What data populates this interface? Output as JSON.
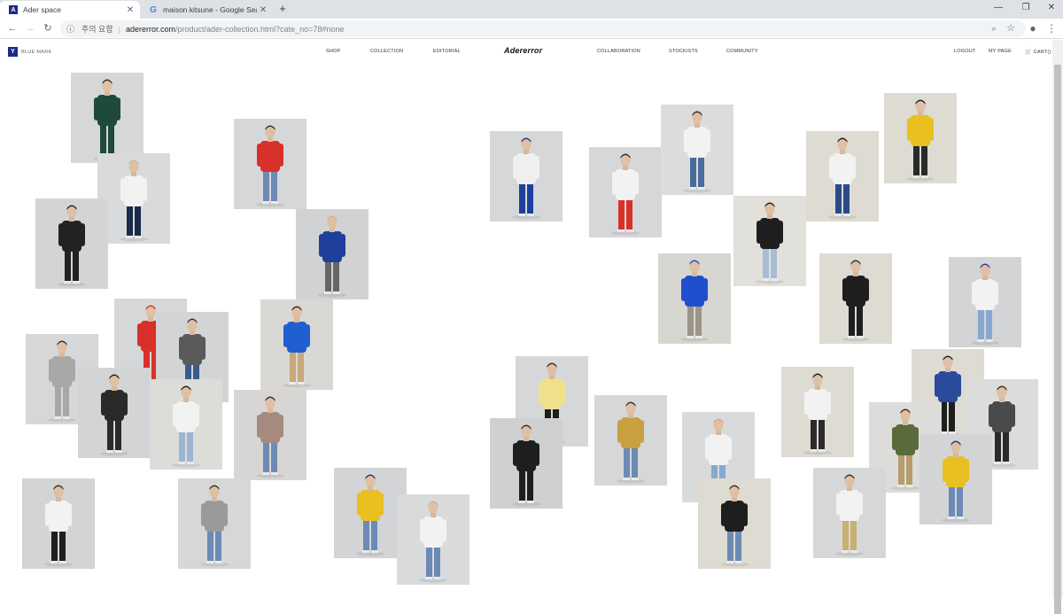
{
  "browser": {
    "tabs": [
      {
        "title": "Ader space",
        "favicon": "A",
        "active": true
      },
      {
        "title": "maison kitsune - Google Search",
        "favicon": "G",
        "active": false
      }
    ],
    "new_tab": "+",
    "window_controls": {
      "minimize": "—",
      "restore": "❐",
      "close": "✕"
    },
    "nav": {
      "back": "←",
      "forward": "→",
      "reload": "↻"
    },
    "address": {
      "warning": "주의 요함",
      "host": "adererror.com",
      "path": "/product/ader-collection.html?cate_no=78#none"
    },
    "toolbar_icons": {
      "zoom": "🔍",
      "star": "☆",
      "profile": "●",
      "menu": "⋮"
    }
  },
  "site": {
    "left_logo_mark": "Y",
    "left_logo_text": "BLUE MARK",
    "menu": [
      "SHOP",
      "COLLECTION",
      "EDITORIAL",
      "COLLABORATION",
      "STOCKISTS",
      "COMMUNITY"
    ],
    "brand": "Adererror",
    "account": {
      "logout": "LOGOUT",
      "mypage": "MY PAGE",
      "cart": "CART()"
    }
  },
  "lookbook": [
    {
      "id": 1,
      "bg": "#d6d7d9",
      "top": "#1e4a3c",
      "bottom": "#1e4a3c",
      "hair": "#3a2a1c"
    },
    {
      "id": 2,
      "bg": "#d9dadb",
      "top": "#f2f2f2",
      "bottom": "#1c2a4a",
      "hair": "#c9b48c"
    },
    {
      "id": 3,
      "bg": "#d3d4d6",
      "top": "#222222",
      "bottom": "#222222",
      "hair": "#222222"
    },
    {
      "id": 4,
      "bg": "#d6d7d9",
      "top": "#d8302a",
      "bottom": "#6c8ab5",
      "hair": "#3a2a1c"
    },
    {
      "id": 5,
      "bg": "#d1d2d4",
      "top": "#1f3f9c",
      "bottom": "#666666",
      "hair": "#c9b48c"
    },
    {
      "id": 6,
      "bg": "#d6d7d9",
      "top": "#d8302a",
      "bottom": "#d8302a",
      "hair": "#d8302a"
    },
    {
      "id": 7,
      "bg": "#d3d4d6",
      "top": "#5a5a5a",
      "bottom": "#3c5a8c",
      "hair": "#2a2f6c"
    },
    {
      "id": 8,
      "bg": "#d9d8d4",
      "top": "#1f5fcf",
      "bottom": "#c9a87a",
      "hair": "#3a2a1c"
    },
    {
      "id": 9,
      "bg": "#d6d7d9",
      "top": "#a8a8a8",
      "bottom": "#a8a8a8",
      "hair": "#3a2a1c"
    },
    {
      "id": 10,
      "bg": "#d3d4d6",
      "top": "#2a2a2a",
      "bottom": "#2a2a2a",
      "hair": "#1c1c1c"
    },
    {
      "id": 11,
      "bg": "#dcdcd8",
      "top": "#f2f2f2",
      "bottom": "#9cb5d3",
      "hair": "#1c1c1c"
    },
    {
      "id": 12,
      "bg": "#d7d6d4",
      "top": "#a68a80",
      "bottom": "#6c8ab5",
      "hair": "#3a2a1c"
    },
    {
      "id": 13,
      "bg": "#d6d7d9",
      "top": "#efefef",
      "bottom": "#1f3f9c",
      "hair": "#2a2f6c"
    },
    {
      "id": 14,
      "bg": "#d6d7d9",
      "top": "#f2f2f2",
      "bottom": "#d8302a",
      "hair": "#3a2a1c"
    },
    {
      "id": 15,
      "bg": "#dcdcda",
      "top": "#f2f2f2",
      "bottom": "#4a6c9c",
      "hair": "#3a2a1c"
    },
    {
      "id": 16,
      "bg": "#e2e0da",
      "top": "#1e1e1e",
      "bottom": "#a8bcd3",
      "hair": "#1c1c1c"
    },
    {
      "id": 17,
      "bg": "#dedbd3",
      "top": "#f2f2f2",
      "bottom": "#2a4a8c",
      "hair": "#1c1c1c"
    },
    {
      "id": 18,
      "bg": "#dedbd3",
      "top": "#e8c020",
      "bottom": "#2a2a2a",
      "hair": "#1c1c1c"
    },
    {
      "id": 19,
      "bg": "#d8d6d0",
      "top": "#1f4fcf",
      "bottom": "#9c948a",
      "hair": "#1f4fcf"
    },
    {
      "id": 20,
      "bg": "#dedbd3",
      "top": "#1e1e1e",
      "bottom": "#1e1e1e",
      "hair": "#3a2a1c"
    },
    {
      "id": 21,
      "bg": "#d3d4d6",
      "top": "#f2f2f2",
      "bottom": "#8aa8cf",
      "hair": "#3a3a8c"
    },
    {
      "id": 22,
      "bg": "#d6d7d9",
      "top": "#efe08c",
      "bottom": "#1e1e1e",
      "hair": "#3a2a1c"
    },
    {
      "id": 23,
      "bg": "#cfd0d2",
      "top": "#1e1e1e",
      "bottom": "#1e1e1e",
      "hair": "#3a2a1c"
    },
    {
      "id": 24,
      "bg": "#d6d7d9",
      "top": "#c8a040",
      "bottom": "#6c8ab5",
      "hair": "#3a2a1c"
    },
    {
      "id": 25,
      "bg": "#d9dadb",
      "top": "#f2f2f2",
      "bottom": "#8aa8cf",
      "hair": "#d8a0a0"
    },
    {
      "id": 26,
      "bg": "#dedbd3",
      "top": "#1e1e1e",
      "bottom": "#6c8ab5",
      "hair": "#3a2a1c"
    },
    {
      "id": 27,
      "bg": "#dedbd3",
      "top": "#f2f2f2",
      "bottom": "#2a2a2a",
      "hair": "#1c1c1c"
    },
    {
      "id": 28,
      "bg": "#dedbd3",
      "top": "#2a4a9c",
      "bottom": "#1e1e1e",
      "hair": "#1c1c1c"
    },
    {
      "id": 29,
      "bg": "#dcdcda",
      "top": "#4a4a4a",
      "bottom": "#2a2a2a",
      "hair": "#3a2a1c"
    },
    {
      "id": 30,
      "bg": "#dcdcda",
      "top": "#5a6a3a",
      "bottom": "#b89c6c",
      "hair": "#3a2a1c"
    },
    {
      "id": 31,
      "bg": "#d3d4d6",
      "top": "#e8c020",
      "bottom": "#6c8ab5",
      "hair": "#2a2f6c"
    },
    {
      "id": 32,
      "bg": "#d6d7d9",
      "top": "#f2f2f2",
      "bottom": "#c8b070",
      "hair": "#3a2a1c"
    },
    {
      "id": 33,
      "bg": "#d3d4d6",
      "top": "#f2f2f2",
      "bottom": "#1e1e1e",
      "hair": "#3a2a1c"
    },
    {
      "id": 34,
      "bg": "#d6d7d9",
      "top": "#9a9a9a",
      "bottom": "#6c8ab5",
      "hair": "#3a2a1c"
    },
    {
      "id": 35,
      "bg": "#d3d4d6",
      "top": "#e8c020",
      "bottom": "#6c8ab5",
      "hair": "#2a2f6c"
    },
    {
      "id": 36,
      "bg": "#d9dadb",
      "top": "#f2f2f2",
      "bottom": "#6c8ab5",
      "hair": "#c9b48c"
    }
  ]
}
